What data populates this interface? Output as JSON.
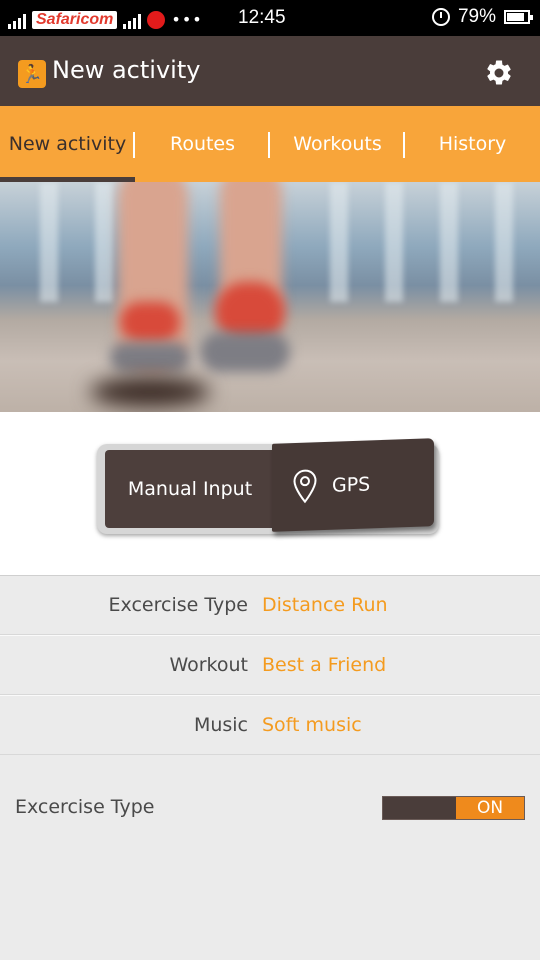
{
  "status_bar": {
    "carrier": "Safaricom",
    "time": "12:45",
    "battery": "79%",
    "icons": [
      "signal-icon",
      "airtel-icon",
      "more-dots-icon",
      "alarm-icon",
      "battery-icon"
    ]
  },
  "app_bar": {
    "title": "New activity",
    "icon": "runner-icon",
    "settings_icon": "gear-icon"
  },
  "tabs": [
    {
      "label": "New activity",
      "active": true
    },
    {
      "label": "Routes",
      "active": false
    },
    {
      "label": "Workouts",
      "active": false
    },
    {
      "label": "History",
      "active": false
    }
  ],
  "mode_switch": {
    "manual_label": "Manual Input",
    "gps_label": "GPS",
    "selected": "GPS"
  },
  "settings": [
    {
      "label": "Excercise Type",
      "value": "Distance Run"
    },
    {
      "label": "Workout",
      "value": "Best a Friend"
    },
    {
      "label": "Music",
      "value": "Soft music"
    }
  ],
  "toggle": {
    "label": "Excercise Type",
    "state": "ON"
  },
  "colors": {
    "accent": "#f8a53a",
    "dark": "#4a3d3a",
    "value_text": "#f49b1f"
  }
}
